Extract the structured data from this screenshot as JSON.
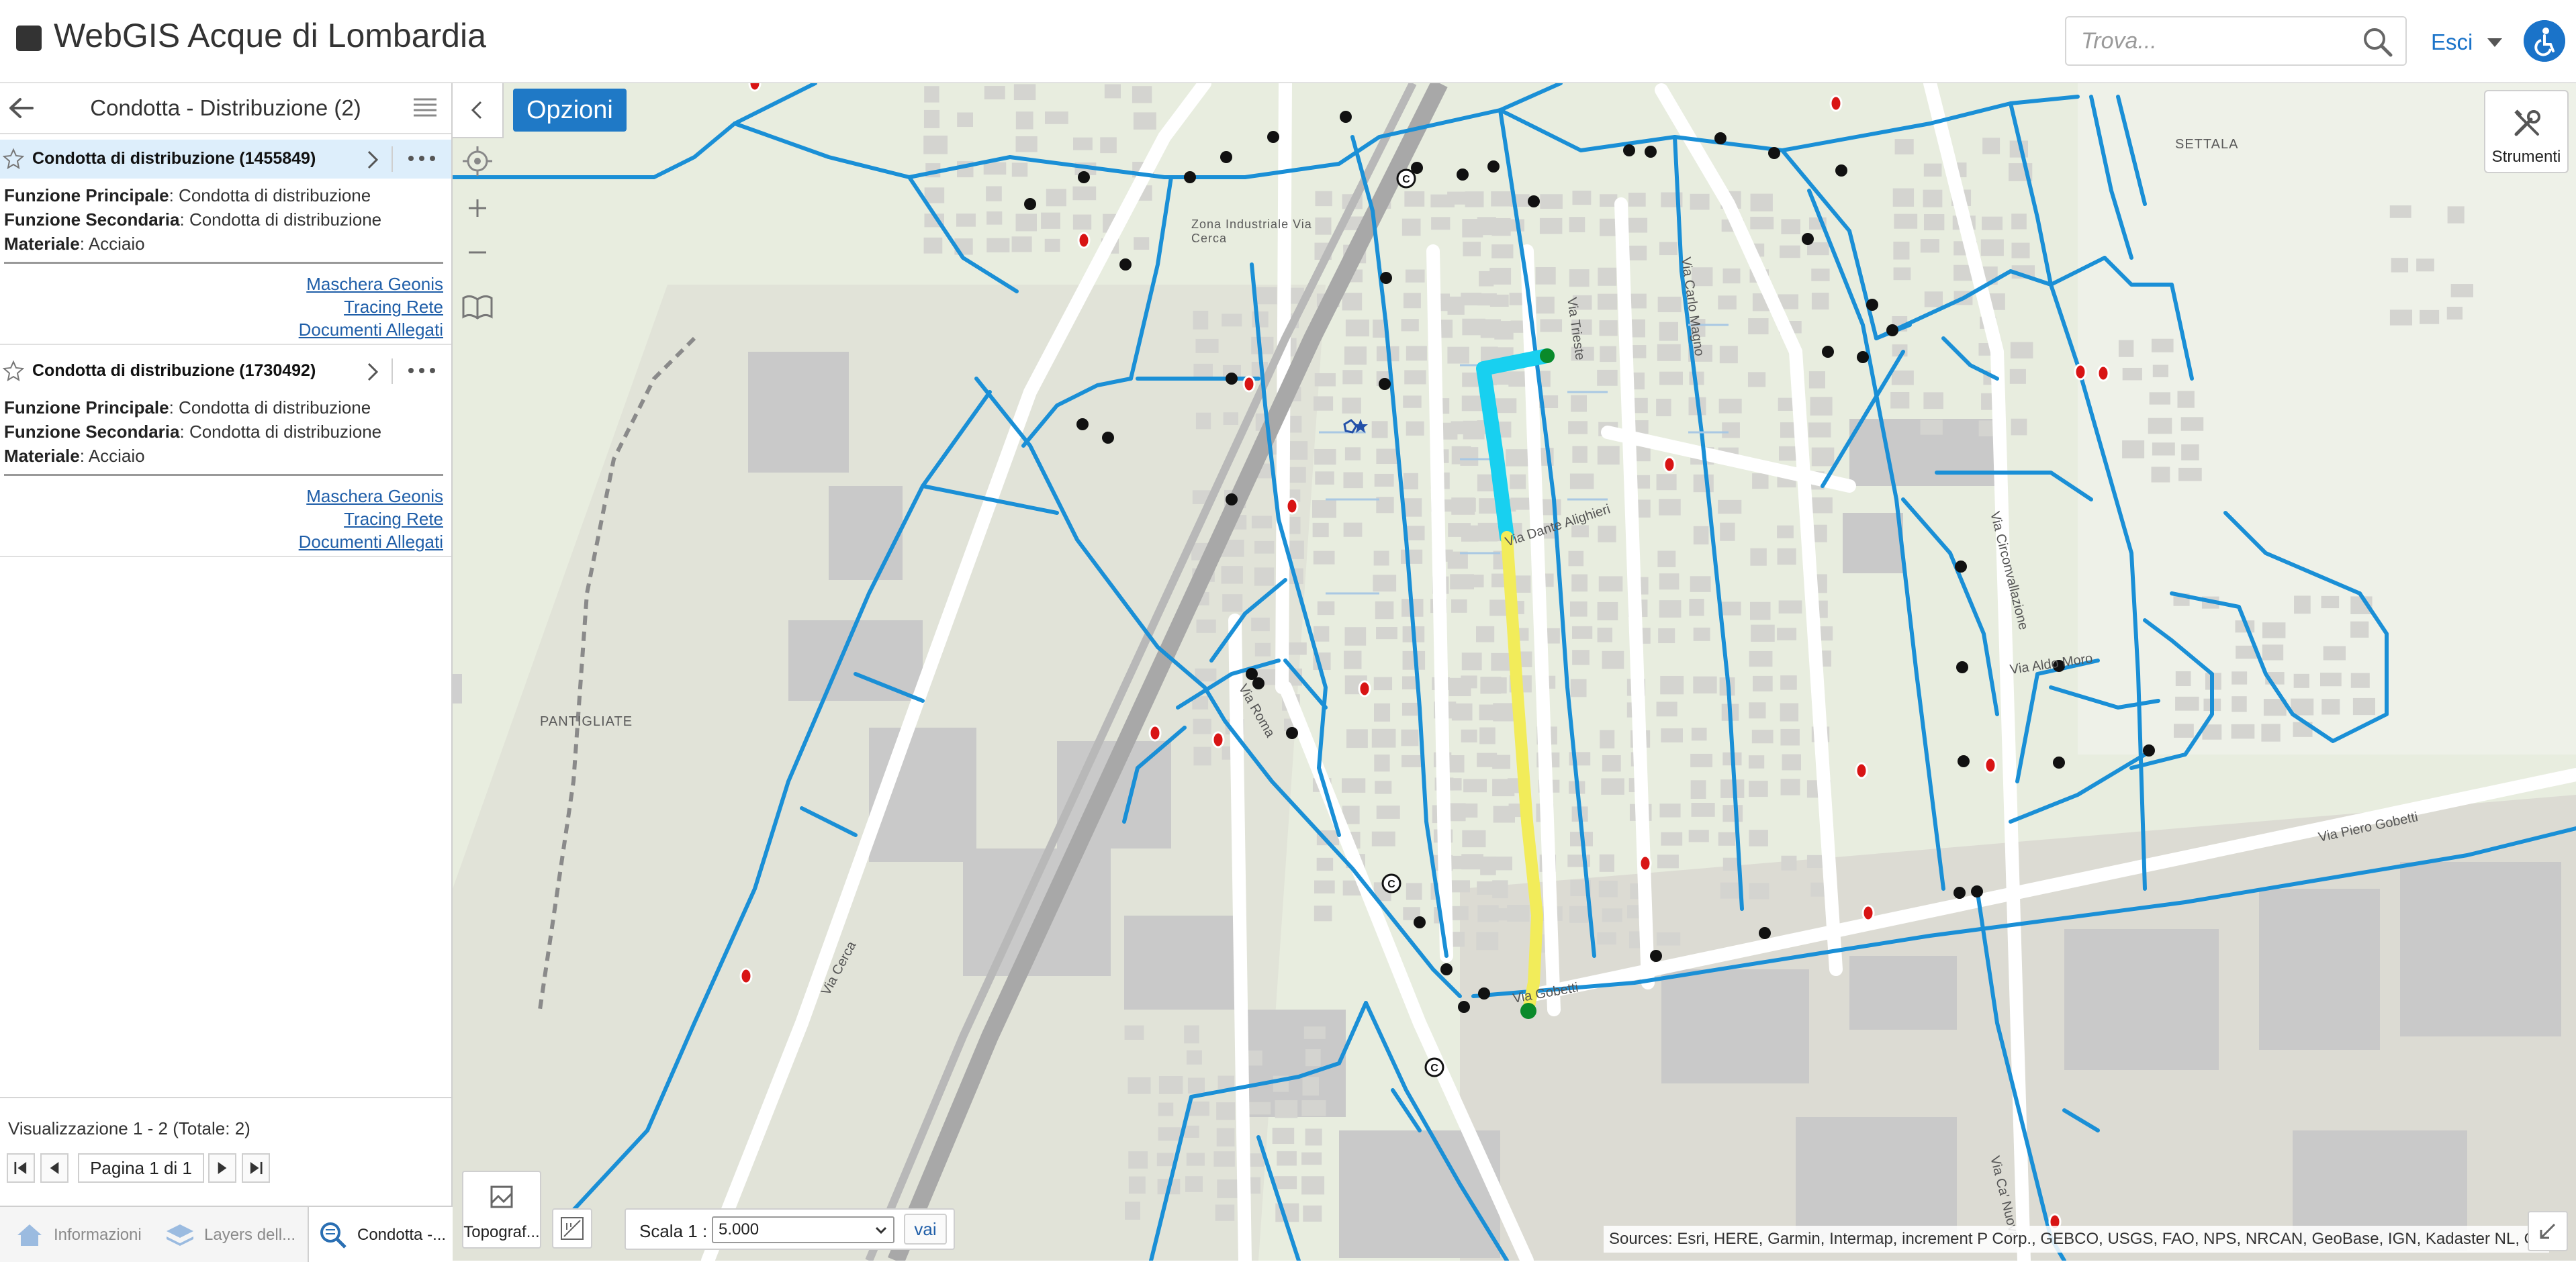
{
  "app": {
    "title": "WebGIS Acque di Lombardia"
  },
  "header": {
    "search_placeholder": "Trova...",
    "logout_label": "Esci"
  },
  "panel": {
    "title": "Condotta - Distribuzione (2)",
    "results": [
      {
        "title": "Condotta di distribuzione (1455849)",
        "attributes": [
          {
            "label": "Funzione Principale",
            "value": ": Condotta di distribuzione"
          },
          {
            "label": "Funzione Secondaria",
            "value": ": Condotta di distribuzione"
          },
          {
            "label": "Materiale",
            "value": ": Acciaio"
          }
        ],
        "links": [
          "Maschera Geonis",
          "Tracing Rete",
          "Documenti Allegati"
        ]
      },
      {
        "title": "Condotta di distribuzione (1730492)",
        "attributes": [
          {
            "label": "Funzione Principale",
            "value": ": Condotta di distribuzione"
          },
          {
            "label": "Funzione Secondaria",
            "value": ": Condotta di distribuzione"
          },
          {
            "label": "Materiale",
            "value": ": Acciaio"
          }
        ],
        "links": [
          "Maschera Geonis",
          "Tracing Rete",
          "Documenti Allegati"
        ]
      }
    ],
    "pager_summary": "Visualizzazione 1 - 2 (Totale: 2)",
    "pager_page": "Pagina 1 di 1"
  },
  "tabs": [
    {
      "label": "Informazioni"
    },
    {
      "label": "Layers dell..."
    },
    {
      "label": "Condotta -..."
    }
  ],
  "map": {
    "options_label": "Opzioni",
    "tools_label": "Strumenti",
    "basemap_label": "Topograf...",
    "scale_label": "Scala 1 :",
    "scale_value": "5.000",
    "scale_go": "vai",
    "attribution": "Sources: Esri, HERE, Garmin, Intermap, increment P Corp., GEBCO, USGS, FAO, NPS, NRCAN, GeoBase, IGN, Kadaster NL, Ord",
    "place_labels": [
      "SETTALA",
      "PANTIGLIATE",
      "Zona Industriale Via Cerca"
    ],
    "street_labels": [
      "Via Dante Alighieri",
      "Via Gobetti",
      "Via Piero Gobetti",
      "Via Aldo Moro",
      "Via Circonvallazione",
      "Via Carlo Magno",
      "Via Trieste",
      "Via Ca' Nuova",
      "Via Roma",
      "Via Cerca"
    ],
    "colors": {
      "pipe": "#1a8fd6",
      "selected_pipe_a": "#18d0f0",
      "selected_pipe_b": "#f2ec5a",
      "node": "#111111",
      "valve": "#d81414",
      "map_bg": "#e8eddf"
    }
  }
}
